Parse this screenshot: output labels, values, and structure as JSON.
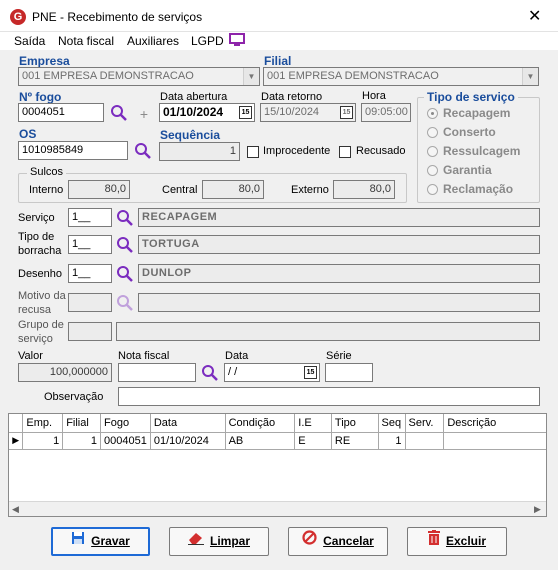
{
  "window": {
    "title": "PNE - Recebimento de serviços",
    "app_icon_letter": "G",
    "close_glyph": "✕"
  },
  "menu": {
    "items": [
      "Saída",
      "Nota fiscal",
      "Auxiliares",
      "LGPD"
    ]
  },
  "empresa": {
    "label": "Empresa",
    "value": "001 EMPRESA DEMONSTRACAO"
  },
  "filial": {
    "label": "Filial",
    "value": "001 EMPRESA DEMONSTRACAO"
  },
  "fogo": {
    "label": "Nº fogo",
    "value": "0004051"
  },
  "data_abertura": {
    "label": "Data abertura",
    "value": "01/10/2024"
  },
  "data_retorno": {
    "label": "Data retorno",
    "value": "15/10/2024"
  },
  "hora": {
    "label": "Hora",
    "value": "09:05:00"
  },
  "os": {
    "label": "OS",
    "value": "1010985849"
  },
  "sequencia": {
    "label": "Sequência",
    "value": "1"
  },
  "improcedente": {
    "label": "Improcedente",
    "checked": false
  },
  "recusado": {
    "label": "Recusado",
    "checked": false
  },
  "sulcos": {
    "label": "Sulcos",
    "interno": {
      "label": "Interno",
      "value": "80,0"
    },
    "central": {
      "label": "Central",
      "value": "80,0"
    },
    "externo": {
      "label": "Externo",
      "value": "80,0"
    }
  },
  "tipo_servico": {
    "label": "Tipo de serviço",
    "options": [
      "Recapagem",
      "Conserto",
      "Ressulcagem",
      "Garantia",
      "Reclamação"
    ],
    "selected": "Recapagem"
  },
  "servico": {
    "label": "Serviço",
    "code": "1__",
    "desc": "RECAPAGEM"
  },
  "borracha": {
    "label1": "Tipo de",
    "label2": "borracha",
    "code": "1__",
    "desc": "TORTUGA"
  },
  "desenho": {
    "label": "Desenho",
    "code": "1__",
    "desc": "DUNLOP"
  },
  "motivo": {
    "label1": "Motivo da",
    "label2": "recusa",
    "code": "",
    "desc": ""
  },
  "grupo": {
    "label1": "Grupo de",
    "label2": "serviço",
    "code": "",
    "desc": ""
  },
  "valor": {
    "label": "Valor",
    "value": "100,000000"
  },
  "nota_fiscal": {
    "label": "Nota fiscal",
    "value": ""
  },
  "data_nf": {
    "label": "Data",
    "value": " / /"
  },
  "serie": {
    "label": "Série",
    "value": ""
  },
  "observacao": {
    "label": "Observação",
    "value": ""
  },
  "grid": {
    "columns": [
      "Emp.",
      "Filial",
      "Fogo",
      "Data",
      "Condição",
      "I.E",
      "Tipo",
      "Seq",
      "Serv.",
      "Descrição"
    ],
    "rows": [
      {
        "emp": "1",
        "filial": "1",
        "fogo": "0004051",
        "data": "01/10/2024",
        "condicao": "AB",
        "ie": "E",
        "tipo": "RE",
        "seq": "1",
        "serv": "",
        "descricao": ""
      }
    ]
  },
  "buttons": {
    "gravar": {
      "label": "Gravar",
      "icon": "floppy-disk-icon",
      "accent": "#1e6ad6"
    },
    "limpar": {
      "label": "Limpar",
      "icon": "eraser-icon",
      "accent": "#d32f2f"
    },
    "cancelar": {
      "label": "Cancelar",
      "icon": "cancel-circle-icon",
      "accent": "#d32f2f"
    },
    "excluir": {
      "label": "Excluir",
      "icon": "trash-icon",
      "accent": "#d32f2f"
    }
  },
  "colors": {
    "label_blue": "#1a4d9c",
    "search_purple": "#7b2cbf",
    "lgpd_icon": "#8e24aa"
  }
}
